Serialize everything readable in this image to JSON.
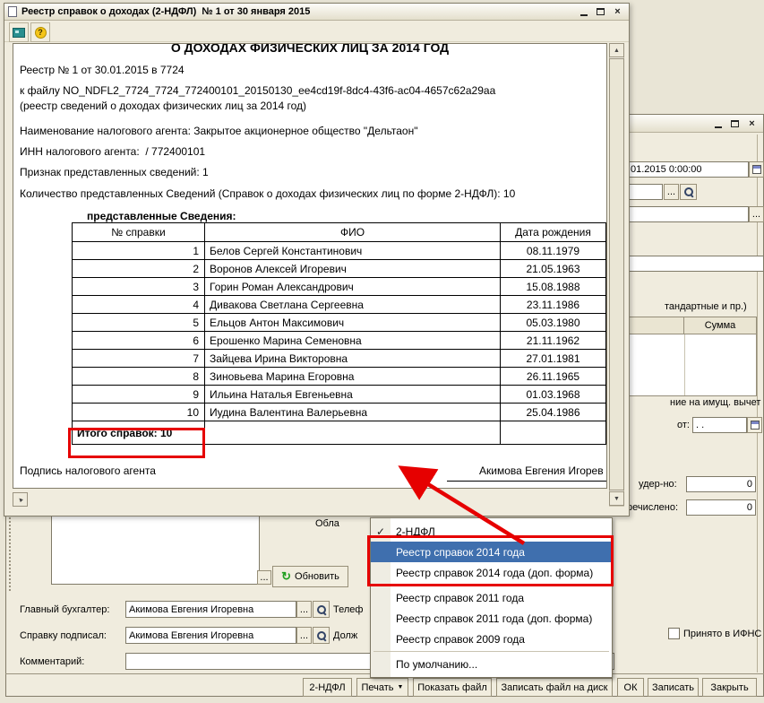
{
  "app": {
    "glyphs": {
      "close": "×",
      "up": "▲",
      "down": "▼",
      "left": "◄",
      "check": "✓",
      "dropdown": "▼",
      "help": "?",
      "refresh": "↻",
      "dots": "..."
    },
    "colors": {
      "annotation_red": "#E60000",
      "menu_selection": "#3F6FAE",
      "help_yellow": "#F5C518",
      "preview_teal": "#2A8F8F",
      "refresh_green": "#1E9E1E",
      "app_beige": "#E9E5D6"
    }
  },
  "report": {
    "title": "Реестр справок о доходах (2-НДФЛ)  № 1 от 30 января 2015",
    "doc": {
      "heading": "О ДОХОДАХ ФИЗИЧЕСКИХ ЛИЦ ЗА 2014 ГОД",
      "reg_line": "Реестр № 1 от 30.01.2015 в 7724",
      "file_line": "к файлу NO_NDFL2_7724_7724_772400101_20150130_ee4cd19f-8dc4-43f6-ac04-4657c62a29aa",
      "file_note": "(реестр сведений о доходах физических лиц за 2014 год)",
      "agent_line": "Наименование налогового агента: Закрытое акционерное общество \"Дельтаон\"",
      "inn_line": "ИНН налогового агента:  / 772400101",
      "attr_line": "Признак представленных сведений: 1",
      "count_line": "Количество представленных Сведений (Справок о доходах физических лиц по форме 2-НДФЛ): 10",
      "table_caption": "представленные Сведения:",
      "table": {
        "headers": [
          "№ справки",
          "ФИО",
          "Дата рождения"
        ],
        "rows": [
          [
            "1",
            "Белов Сергей Константинович",
            "08.11.1979"
          ],
          [
            "2",
            "Воронов Алексей Игоревич",
            "21.05.1963"
          ],
          [
            "3",
            "Горин Роман Александрович",
            "15.08.1988"
          ],
          [
            "4",
            "Дивакова Светлана Сергеевна",
            "23.11.1986"
          ],
          [
            "5",
            "Ельцов Антон Максимович",
            "05.03.1980"
          ],
          [
            "6",
            "Ерошенко Марина Семеновна",
            "21.11.1962"
          ],
          [
            "7",
            "Зайцева Ирина Викторовна",
            "27.01.1981"
          ],
          [
            "8",
            "Зиновьева Марина Егоровна",
            "26.11.1965"
          ],
          [
            "9",
            "Ильина Наталья Евгеньевна",
            "01.03.1968"
          ],
          [
            "10",
            "Иудина Валентина Валерьевна",
            "25.04.1986"
          ]
        ],
        "total": "Итого справок: 10"
      },
      "sign_label": "Подпись налогового агента",
      "signature": "Акимова Евгения Игорев"
    }
  },
  "form": {
    "period_value": "01.2015 0:00:00",
    "empty_date": ". .",
    "labels": {
      "standard_cut": "тандартные и пр.)",
      "sum_header": "Сумма",
      "imush_cut": "ние на имущ. вычет",
      "from": "от:",
      "withheld_cut": "удер-но:",
      "withheld_value": "0",
      "transferred_cut": "речислено:",
      "transferred_value": "0",
      "accepted": "Принято в ИФНС",
      "oblast_cut": "Обла",
      "phone_cut": "Телеф",
      "position_cut": "Долж",
      "chief_accountant": "Главный бухгалтер:",
      "signed_by": "Справку подписал:",
      "comment": "Комментарий:"
    },
    "values": {
      "chief_accountant": "Акимова Евгения Игоревна",
      "signed_by": "Акимова Евгения Игоревна",
      "comment": ""
    },
    "refresh_button": "Обновить",
    "footer": {
      "ndfl": "2-НДФЛ",
      "print": "Печать",
      "show_file": "Показать файл",
      "save_file": "Записать файл на диск",
      "ok": "ОК",
      "save": "Записать",
      "close": "Закрыть"
    }
  },
  "menu": {
    "items": [
      {
        "label": "2-НДФЛ"
      },
      {
        "label": "Реестр справок 2014 года"
      },
      {
        "label": "Реестр справок 2014 года (доп. форма)"
      },
      {
        "label": "Реестр справок 2011 года"
      },
      {
        "label": "Реестр справок 2011 года (доп. форма)"
      },
      {
        "label": "Реестр справок 2009 года"
      },
      {
        "label": "По умолчанию..."
      }
    ]
  }
}
